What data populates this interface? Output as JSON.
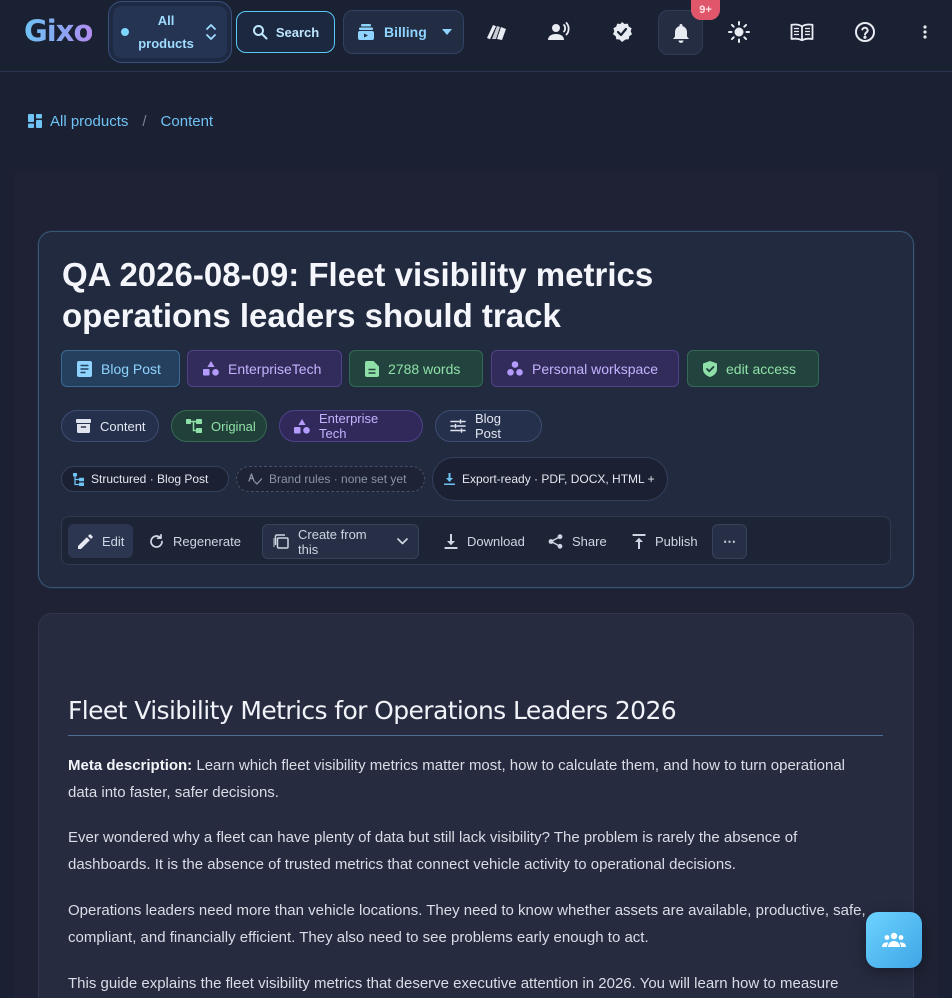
{
  "app": {
    "logo": "Gixo"
  },
  "topbar": {
    "product_switch": "All products",
    "search_label": "Search",
    "billing_label": "Billing",
    "notification_badge": "9+"
  },
  "breadcrumb": {
    "root": "All products",
    "separator": "/",
    "current": "Content"
  },
  "document": {
    "title": "QA 2026-08-09: Fleet visibility metrics operations leaders should track",
    "tags": [
      {
        "label": "Blog Post",
        "icon": "document-icon"
      },
      {
        "label": "EnterpriseTech",
        "icon": "shapes-icon"
      },
      {
        "label": "2788 words",
        "icon": "word-count-icon"
      },
      {
        "label": "Personal workspace",
        "icon": "workspace-icon"
      },
      {
        "label": "edit access",
        "icon": "shield-icon"
      }
    ],
    "chips": [
      {
        "label": "Content",
        "icon": "archive-icon"
      },
      {
        "label": "Original",
        "icon": "tree-icon"
      },
      {
        "label": "Enterprise Tech",
        "icon": "shapes-icon"
      },
      {
        "label": "Blog Post",
        "icon": "sliders-icon"
      }
    ],
    "meta": {
      "structure": "Structured · Blog Post",
      "brand_rules": "Brand rules · none set yet",
      "export": "Export-ready · PDF, DOCX, HTML +"
    }
  },
  "toolbar": {
    "edit": "Edit",
    "regenerate": "Regenerate",
    "create_from": "Create from this",
    "download": "Download",
    "share": "Share",
    "publish": "Publish",
    "more": "⋯"
  },
  "article": {
    "heading": "Fleet Visibility Metrics for Operations Leaders 2026",
    "meta_label": "Meta description:",
    "meta_text": " Learn which fleet visibility metrics matter most, how to calculate them, and how to turn operational data into faster, safer decisions.",
    "p1": "Ever wondered why a fleet can have plenty of data but still lack visibility? The problem is rarely the absence of dashboards. It is the absence of trusted metrics that connect vehicle activity to operational decisions.",
    "p2": "Operations leaders need more than vehicle locations. They need to know whether assets are available, productive, safe, compliant, and financially efficient. They also need to see problems early enough to act.",
    "p3": "This guide explains the fleet visibility metrics that deserve executive attention in 2026. You will learn how to measure"
  },
  "colors": {
    "accent": "#6fc3f5",
    "background": "#1b2133",
    "card": "#222a3f",
    "badge": "#e0576b"
  }
}
